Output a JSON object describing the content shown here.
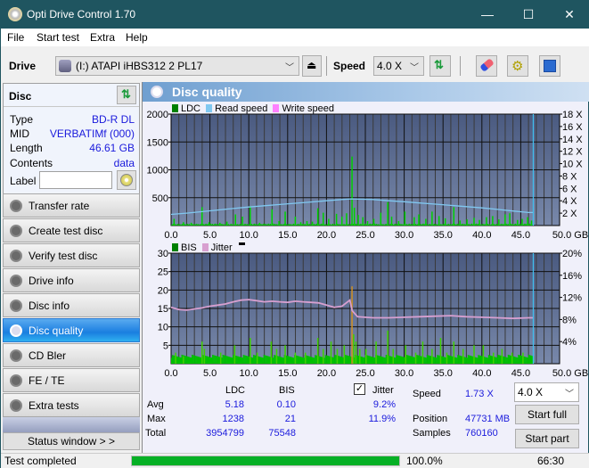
{
  "window": {
    "title": "Opti Drive Control 1.70",
    "minimize_label": "—",
    "maximize_label": "☐",
    "close_label": "✕"
  },
  "menu": [
    "File",
    "Start test",
    "Extra",
    "Help"
  ],
  "toolbar": {
    "drive_label": "Drive",
    "drive_value": "(I:)  ATAPI iHBS312   2 PL17",
    "speed_label": "Speed",
    "speed_value": "4.0 X"
  },
  "disc": {
    "header": "Disc",
    "fields": [
      {
        "key": "Type",
        "value": "BD-R DL"
      },
      {
        "key": "MID",
        "value": "VERBATIMf (000)"
      },
      {
        "key": "Length",
        "value": "46.61 GB"
      },
      {
        "key": "Contents",
        "value": "data"
      }
    ],
    "label_key": "Label",
    "label_value": ""
  },
  "nav": [
    {
      "label": "Transfer rate",
      "active": false
    },
    {
      "label": "Create test disc",
      "active": false
    },
    {
      "label": "Verify test disc",
      "active": false
    },
    {
      "label": "Drive info",
      "active": false
    },
    {
      "label": "Disc info",
      "active": false
    },
    {
      "label": "Disc quality",
      "active": true
    },
    {
      "label": "CD Bler",
      "active": false
    },
    {
      "label": "FE / TE",
      "active": false
    },
    {
      "label": "Extra tests",
      "active": false
    }
  ],
  "status_window_label": "Status window > >",
  "panel_title": "Disc quality",
  "colors": {
    "ldc": "#00c000",
    "read_speed": "#80c8f0",
    "write_speed": "#ff80ff",
    "bis": "#00c000",
    "jitter": "#d8a0d0",
    "plot_bg": "#5a6a90",
    "accent_active": "#1a7ee0",
    "value_blue": "#1a1adc",
    "progress": "#06b025"
  },
  "chart_data": [
    {
      "type": "bar",
      "title": "LDC / Read speed",
      "legend": [
        "LDC",
        "Read speed",
        "Write speed"
      ],
      "legend_placement": "top-left",
      "xlabel": "GB",
      "x_ticks": [
        "0.0",
        "5.0",
        "10.0",
        "15.0",
        "20.0",
        "25.0",
        "30.0",
        "35.0",
        "40.0",
        "45.0",
        "50.0 GB"
      ],
      "xlim": [
        0,
        50
      ],
      "y_left_ticks": [
        "500",
        "1000",
        "1500",
        "2000"
      ],
      "ylim_left": [
        0,
        2000
      ],
      "y_right_ticks": [
        "2 X",
        "4 X",
        "6 X",
        "8 X",
        "10 X",
        "12 X",
        "14 X",
        "16 X",
        "18 X"
      ],
      "ylim_right": [
        0,
        18
      ],
      "grid": true,
      "end_marker_gb": 46.61,
      "ldc_spikes": [
        [
          0.3,
          120
        ],
        [
          1.5,
          60
        ],
        [
          2.5,
          50
        ],
        [
          3.9,
          330
        ],
        [
          4.8,
          60
        ],
        [
          6.2,
          50
        ],
        [
          7.1,
          70
        ],
        [
          8.2,
          200
        ],
        [
          9.1,
          160
        ],
        [
          10.1,
          350
        ],
        [
          11.3,
          50
        ],
        [
          12.9,
          290
        ],
        [
          13.8,
          80
        ],
        [
          14.6,
          250
        ],
        [
          15.9,
          160
        ],
        [
          16.6,
          60
        ],
        [
          17.4,
          80
        ],
        [
          18.1,
          70
        ],
        [
          18.8,
          310
        ],
        [
          19.5,
          230
        ],
        [
          20.2,
          120
        ],
        [
          21.2,
          210
        ],
        [
          21.9,
          160
        ],
        [
          22.5,
          220
        ],
        [
          23.2,
          1238
        ],
        [
          23.5,
          320
        ],
        [
          24.0,
          190
        ],
        [
          24.6,
          150
        ],
        [
          25.2,
          80
        ],
        [
          26.0,
          120
        ],
        [
          26.9,
          230
        ],
        [
          27.8,
          420
        ],
        [
          28.3,
          160
        ],
        [
          29.2,
          80
        ],
        [
          30.0,
          250
        ],
        [
          31.2,
          150
        ],
        [
          31.8,
          200
        ],
        [
          32.7,
          120
        ],
        [
          33.5,
          250
        ],
        [
          34.4,
          170
        ],
        [
          35.2,
          130
        ],
        [
          36.3,
          330
        ],
        [
          37.1,
          90
        ],
        [
          38.0,
          110
        ],
        [
          38.9,
          140
        ],
        [
          39.6,
          100
        ],
        [
          40.5,
          150
        ],
        [
          41.3,
          170
        ],
        [
          42.1,
          110
        ],
        [
          42.9,
          200
        ],
        [
          43.5,
          220
        ],
        [
          44.5,
          100
        ],
        [
          45.1,
          120
        ],
        [
          45.8,
          150
        ],
        [
          46.3,
          90
        ]
      ],
      "read_speed_steps": [
        [
          0,
          1.8
        ],
        [
          2,
          2.0
        ],
        [
          4,
          2.25
        ],
        [
          6,
          2.5
        ],
        [
          8,
          2.75
        ],
        [
          10,
          3.0
        ],
        [
          12,
          3.2
        ],
        [
          14,
          3.4
        ],
        [
          16,
          3.6
        ],
        [
          18,
          3.8
        ],
        [
          20,
          4.0
        ],
        [
          22,
          4.2
        ],
        [
          23.2,
          4.3
        ],
        [
          26,
          4.2
        ],
        [
          28,
          4.0
        ],
        [
          30,
          3.85
        ],
        [
          32,
          3.65
        ],
        [
          34,
          3.45
        ],
        [
          36,
          3.25
        ],
        [
          38,
          3.05
        ],
        [
          40,
          2.85
        ],
        [
          42,
          2.6
        ],
        [
          44,
          2.35
        ],
        [
          46,
          2.1
        ],
        [
          46.6,
          2.1
        ]
      ]
    },
    {
      "type": "bar",
      "title": "BIS / Jitter",
      "legend": [
        "BIS",
        "Jitter"
      ],
      "legend_placement": "top-left",
      "xlabel": "GB",
      "x_ticks": [
        "0.0",
        "5.0",
        "10.0",
        "15.0",
        "20.0",
        "25.0",
        "30.0",
        "35.0",
        "40.0",
        "45.0",
        "50.0 GB"
      ],
      "xlim": [
        0,
        50
      ],
      "y_left_ticks": [
        "5",
        "10",
        "15",
        "20",
        "25",
        "30"
      ],
      "ylim_left": [
        0,
        30
      ],
      "y_right_ticks": [
        "4%",
        "8%",
        "12%",
        "16%",
        "20%"
      ],
      "ylim_right": [
        0,
        20
      ],
      "grid": true,
      "end_marker_gb": 46.61,
      "bis_spikes": [
        [
          0.5,
          3
        ],
        [
          1.5,
          2
        ],
        [
          3.9,
          6
        ],
        [
          4.2,
          4
        ],
        [
          6.3,
          3
        ],
        [
          8.1,
          5
        ],
        [
          10.1,
          7
        ],
        [
          11.0,
          3
        ],
        [
          12.8,
          6
        ],
        [
          13.5,
          4
        ],
        [
          14.6,
          5
        ],
        [
          15.9,
          3
        ],
        [
          17.2,
          3
        ],
        [
          18.8,
          7
        ],
        [
          19.5,
          4
        ],
        [
          20.5,
          6
        ],
        [
          21.3,
          4
        ],
        [
          22.2,
          5
        ],
        [
          23.2,
          21
        ],
        [
          23.4,
          8
        ],
        [
          23.7,
          6
        ],
        [
          24.2,
          4
        ],
        [
          25.0,
          4
        ],
        [
          26.3,
          6
        ],
        [
          27.8,
          9
        ],
        [
          28.5,
          4
        ],
        [
          30.1,
          5
        ],
        [
          31.4,
          3
        ],
        [
          32.3,
          6
        ],
        [
          33.5,
          4
        ],
        [
          34.6,
          7
        ],
        [
          35.4,
          3
        ],
        [
          36.3,
          6
        ],
        [
          37.5,
          4
        ],
        [
          38.9,
          5
        ],
        [
          40.1,
          5
        ],
        [
          41.4,
          3
        ],
        [
          42.5,
          4
        ],
        [
          43.8,
          3
        ],
        [
          45.2,
          3
        ]
      ],
      "jitter_points": [
        [
          0,
          10.2
        ],
        [
          1,
          9.8
        ],
        [
          2,
          9.7
        ],
        [
          3,
          9.9
        ],
        [
          4,
          10.1
        ],
        [
          5,
          10.4
        ],
        [
          6,
          10.6
        ],
        [
          7,
          10.8
        ],
        [
          8,
          11.2
        ],
        [
          9,
          11.5
        ],
        [
          10,
          11.6
        ],
        [
          11,
          11.4
        ],
        [
          12,
          11.2
        ],
        [
          13,
          11.3
        ],
        [
          14,
          11.2
        ],
        [
          15,
          11.1
        ],
        [
          16,
          11.3
        ],
        [
          17,
          11.2
        ],
        [
          18,
          11.1
        ],
        [
          19,
          11.0
        ],
        [
          20,
          10.6
        ],
        [
          21,
          10.2
        ],
        [
          22,
          10.4
        ],
        [
          23,
          11.5
        ],
        [
          23.3,
          9.6
        ],
        [
          24,
          8.5
        ],
        [
          26,
          8.3
        ],
        [
          28,
          8.3
        ],
        [
          30,
          8.4
        ],
        [
          32,
          8.5
        ],
        [
          34,
          8.6
        ],
        [
          36,
          8.7
        ],
        [
          38,
          8.5
        ],
        [
          40,
          8.4
        ],
        [
          42,
          8.3
        ],
        [
          44,
          8.2
        ],
        [
          46,
          8.3
        ],
        [
          46.6,
          8.3
        ]
      ]
    }
  ],
  "stats": {
    "col_ldc": "LDC",
    "col_bis": "BIS",
    "jitter_label": "Jitter",
    "jitter_checked": true,
    "rows": [
      {
        "label": "Avg",
        "ldc": "5.18",
        "bis": "0.10",
        "jitter": "9.2%"
      },
      {
        "label": "Max",
        "ldc": "1238",
        "bis": "21",
        "jitter": "11.9%"
      },
      {
        "label": "Total",
        "ldc": "3954799",
        "bis": "75548",
        "jitter": ""
      }
    ],
    "speed_label": "Speed",
    "speed_value": "1.73 X",
    "position_label": "Position",
    "position_value": "47731 MB",
    "samples_label": "Samples",
    "samples_value": "760160",
    "speed_select": "4.0 X",
    "start_full": "Start full",
    "start_part": "Start part"
  },
  "statusbar": {
    "text": "Test completed",
    "progress_percent": 100.0,
    "progress_label": "100.0%",
    "time": "66:30"
  }
}
